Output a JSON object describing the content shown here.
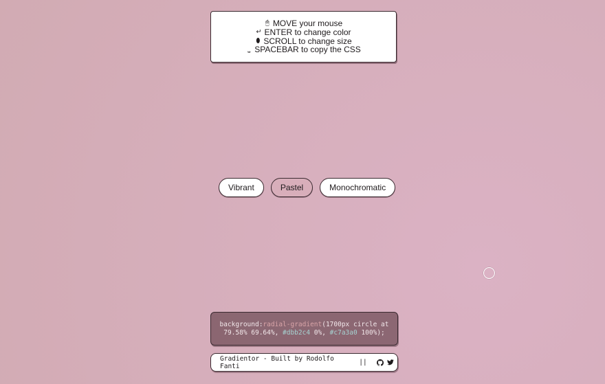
{
  "instructions": {
    "lines": [
      {
        "icon": "🖱",
        "icon_name": "mouse-icon",
        "text": "MOVE your mouse"
      },
      {
        "icon": "↵",
        "icon_name": "enter-key-icon",
        "text": "ENTER to change color"
      },
      {
        "icon": "⬮",
        "icon_name": "scroll-wheel-icon",
        "text": "SCROLL to change size"
      },
      {
        "icon": "⎵",
        "icon_name": "spacebar-icon",
        "text": "SPACEBAR to copy the CSS"
      }
    ]
  },
  "palettes": {
    "items": [
      {
        "label": "Vibrant"
      },
      {
        "label": "Pastel"
      },
      {
        "label": "Monochromatic"
      }
    ],
    "selected": "Pastel"
  },
  "css_output": {
    "property": "background:",
    "function": "radial-gradient",
    "args_start": "(1700px circle at 79.58% 69.64%, ",
    "color1": "#dbb2c4",
    "stop1": " 0%, ",
    "color2": "#c7a3a0",
    "stop2": " 100%);"
  },
  "footer": {
    "credit": "Gradientor - Built by Rodolfo Fanti",
    "separator": "||",
    "github_icon": "github-icon",
    "twitter_icon": "twitter-icon"
  },
  "colors": {
    "gradient_start": "#dbb2c4",
    "gradient_end": "#c7a3a0",
    "active_palette": "#d8aeba"
  }
}
